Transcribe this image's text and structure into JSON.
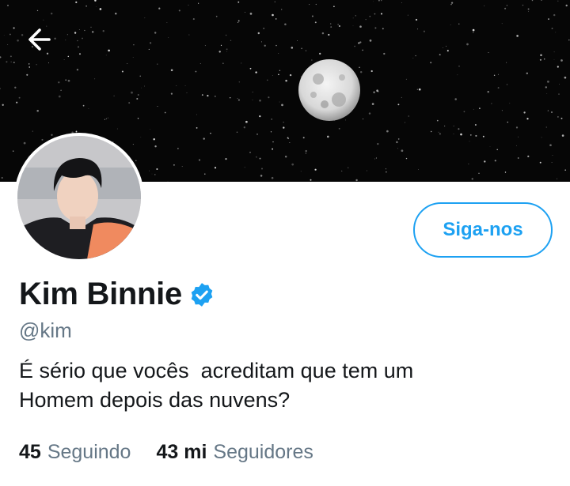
{
  "header": {
    "back_icon": "arrow-left-icon",
    "banner_icon": "moon-night-sky"
  },
  "profile": {
    "display_name": "Kim Binnie",
    "verified": true,
    "verified_icon": "verified-badge-icon",
    "handle": "@kim",
    "bio": "É sério que vocês  acreditam que tem um\nHomem depois das nuvens?",
    "follow_button_label": "Siga-nos"
  },
  "stats": {
    "following_count": "45",
    "following_label": "Seguindo",
    "followers_count": "43 mi",
    "followers_label": "Seguidores"
  },
  "colors": {
    "accent": "#1da1f2",
    "text_primary": "#14171a",
    "text_secondary": "#657786",
    "banner_bg": "#060606"
  }
}
